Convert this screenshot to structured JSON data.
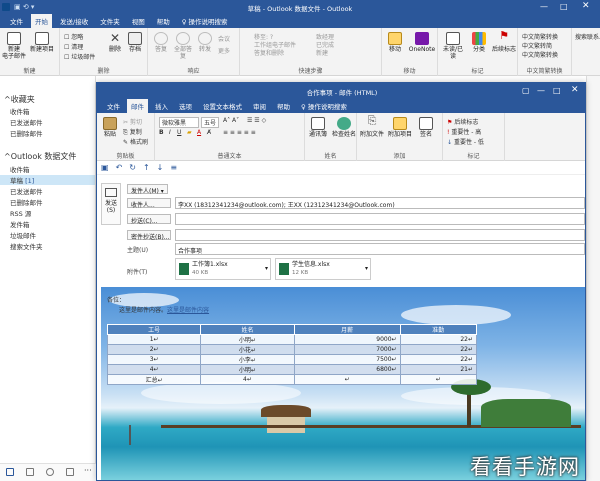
{
  "main_window": {
    "title": "草稿 - Outlook 数据文件 - Outlook",
    "tabs": [
      "文件",
      "开始",
      "发送/接收",
      "文件夹",
      "视图",
      "帮助",
      "♀ 操作说明搜索"
    ],
    "active_tab": 1,
    "ribbon": {
      "new_email": "新建\n电子邮件",
      "new_items": "新建项目",
      "ignore": "忽略",
      "clean_up": "清理",
      "junk": "垃圾邮件",
      "delete_label": "删除",
      "archive_label": "存档",
      "group_new": "新建",
      "group_delete": "删除",
      "reply": "答复",
      "reply_all": "全部答复",
      "forward": "转发",
      "meeting": "会议",
      "more": "更多",
      "group_respond": "响应",
      "quick_steps": [
        "移至: ?",
        "工作组电子邮件",
        "答复和删除",
        "致经理",
        "已完成",
        "新建"
      ],
      "group_quick": "快速步骤",
      "move": "移动",
      "onenote": "OneNote",
      "group_move": "移动",
      "unread": "未读/已读",
      "categorize": "分类",
      "followup": "后续标志",
      "group_tags": "标记",
      "translate": [
        "中文简繁转换",
        "中文繁转简",
        "中文简繁转换"
      ],
      "group_translate": "中文简繁转换",
      "search": "搜索联系人"
    }
  },
  "sidebar": {
    "favorites_header": "^收藏夹",
    "favorites": [
      "收件箱",
      "已发送邮件",
      "已删除邮件"
    ],
    "datafile_header": "^Outlook 数据文件",
    "folders": [
      {
        "label": "收件箱",
        "count": ""
      },
      {
        "label": "草稿",
        "count": "[1]"
      },
      {
        "label": "已发送邮件",
        "count": ""
      },
      {
        "label": "已删除邮件",
        "count": ""
      },
      {
        "label": "RSS 源",
        "count": ""
      },
      {
        "label": "发件箱",
        "count": ""
      },
      {
        "label": "垃圾邮件",
        "count": ""
      },
      {
        "label": "搜索文件夹",
        "count": ""
      }
    ],
    "selected_index": 1
  },
  "compose": {
    "title": "合作事项 - 邮件 (HTML)",
    "tabs": [
      "文件",
      "邮件",
      "插入",
      "选项",
      "设置文本格式",
      "审阅",
      "帮助",
      "♀ 操作说明搜索"
    ],
    "active_tab": 1,
    "ribbon": {
      "paste": "粘贴",
      "cut": "剪切",
      "copy": "复制",
      "format_painter": "格式刷",
      "group_clipboard": "剪贴板",
      "font_name": "微软雅黑",
      "font_size": "五号",
      "group_basic_text": "普通文本",
      "address_book": "通讯簿",
      "check_names": "检查姓名",
      "group_names": "姓名",
      "attach_file": "附加文件",
      "attach_item": "附加项目",
      "signature": "签名",
      "group_include": "添加",
      "followup": "后续标志",
      "high_importance": "重要性 - 高",
      "low_importance": "重要性 - 低",
      "group_tags": "标记"
    },
    "send_label": "发送\n(S)",
    "from_label": "发件人(M) ▾",
    "to_button": "收件人...",
    "cc_button": "抄送(C)...",
    "bcc_button": "密件抄送(B)...",
    "to_value": {
      "r1": "李XX (18312341234@outlook.com)",
      "r2": "王XX (12312341234@Outlook.com)"
    },
    "subject_label": "主题(U)",
    "subject_value": "合作事项",
    "attached_label": "附件(T)",
    "attachments": [
      {
        "name": "工作簿1.xlsx",
        "size": "40 KB"
      },
      {
        "name": "学生信息.xlsx",
        "size": "12 KB"
      }
    ],
    "body": {
      "line1": "各位：",
      "line2_prefix": "这里是邮件内容",
      "line2_link": "这里是邮件内容"
    },
    "table": {
      "headers": [
        "工号",
        "姓名",
        "月薪",
        "准勤"
      ],
      "rows": [
        [
          "1↵",
          "小明↵",
          "9000↵",
          "22↵"
        ],
        [
          "2↵",
          "小花↵",
          "7000↵",
          "22↵"
        ],
        [
          "3↵",
          "小李↵",
          "7500↵",
          "22↵"
        ],
        [
          "4↵",
          "小明↵",
          "6800↵",
          "21↵"
        ],
        [
          "汇总↵",
          "4↵",
          "↵",
          "↵"
        ]
      ]
    }
  },
  "watermark": "看看手游网",
  "colors": {
    "accent": "#2b579a",
    "table_header": "#4f81bd",
    "selection": "#cde6f7"
  }
}
